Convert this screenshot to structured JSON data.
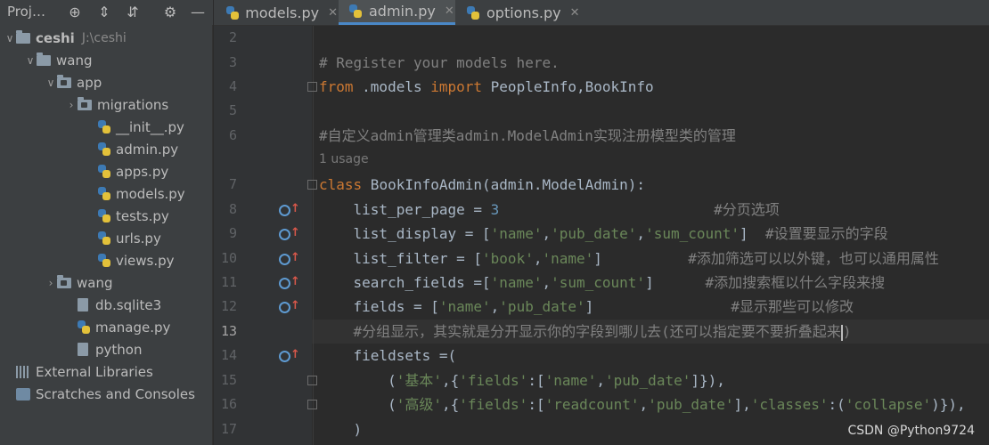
{
  "project": {
    "title": "Proj…",
    "toolbar_icons": [
      "locate-icon",
      "expand-all-icon",
      "collapse-all-icon",
      "settings-icon",
      "hide-icon"
    ],
    "tree": [
      {
        "label": "ceshi",
        "path": "J:\\ceshi",
        "kind": "folder",
        "arrow": "down",
        "indent": 0,
        "bold": true
      },
      {
        "label": "wang",
        "kind": "folder",
        "arrow": "down",
        "indent": 1
      },
      {
        "label": "app",
        "kind": "module-folder",
        "arrow": "down",
        "indent": 2
      },
      {
        "label": "migrations",
        "kind": "module-folder",
        "arrow": "right",
        "indent": 3
      },
      {
        "label": "__init__.py",
        "kind": "py",
        "indent": 4
      },
      {
        "label": "admin.py",
        "kind": "py",
        "indent": 4
      },
      {
        "label": "apps.py",
        "kind": "py",
        "indent": 4
      },
      {
        "label": "models.py",
        "kind": "py",
        "indent": 4
      },
      {
        "label": "tests.py",
        "kind": "py",
        "indent": 4
      },
      {
        "label": "urls.py",
        "kind": "py",
        "indent": 4
      },
      {
        "label": "views.py",
        "kind": "py",
        "indent": 4
      },
      {
        "label": "wang",
        "kind": "module-folder",
        "arrow": "right",
        "indent": 2
      },
      {
        "label": "db.sqlite3",
        "kind": "file",
        "indent": 3
      },
      {
        "label": "manage.py",
        "kind": "py",
        "indent": 3
      },
      {
        "label": "python",
        "kind": "file",
        "indent": 3
      },
      {
        "label": "External Libraries",
        "kind": "lib",
        "indent": 0
      },
      {
        "label": "Scratches and Consoles",
        "kind": "scratch",
        "indent": 0
      }
    ]
  },
  "tabs": [
    {
      "label": "models.py",
      "active": false
    },
    {
      "label": "admin.py",
      "active": true
    },
    {
      "label": "options.py",
      "active": false
    }
  ],
  "editor": {
    "usage_hint": "1 usage",
    "lines": [
      {
        "n": "2",
        "text": ""
      },
      {
        "n": "3",
        "text": "# Register your models here."
      },
      {
        "n": "4",
        "text": "from .models import PeopleInfo,BookInfo"
      },
      {
        "n": "5",
        "text": ""
      },
      {
        "n": "6",
        "text": "#自定义admin管理类admin.ModelAdmin实现注册模型类的管理"
      },
      {
        "n": "7",
        "text": "class BookInfoAdmin(admin.ModelAdmin):"
      },
      {
        "n": "8",
        "text": "    list_per_page = 3                         #分页选项"
      },
      {
        "n": "9",
        "text": "    list_display = ['name','pub_date','sum_count']  #设置要显示的字段"
      },
      {
        "n": "10",
        "text": "    list_filter = ['book','name']          #添加筛选可以以外键，也可以通用属性"
      },
      {
        "n": "11",
        "text": "    search_fields =['name','sum_count']      #添加搜索框以什么字段来搜"
      },
      {
        "n": "12",
        "text": "    fields = ['name','pub_date']                #显示那些可以修改"
      },
      {
        "n": "13",
        "text": "    #分组显示，其实就是分开显示你的字段到哪儿去(还可以指定要不要折叠起来)"
      },
      {
        "n": "14",
        "text": "    fieldsets =("
      },
      {
        "n": "15",
        "text": "        ('基本',{'fields':['name','pub_date']}),"
      },
      {
        "n": "16",
        "text": "        ('高级',{'fields':['readcount','pub_date'],'classes':('collapse')}),"
      },
      {
        "n": "17",
        "text": "    )"
      }
    ]
  },
  "watermark": "CSDN @Python9724",
  "colors": {
    "keyword": "#cc7832",
    "comment": "#808080",
    "string": "#6a8759",
    "number": "#6897bb",
    "text": "#a9b7c6"
  }
}
